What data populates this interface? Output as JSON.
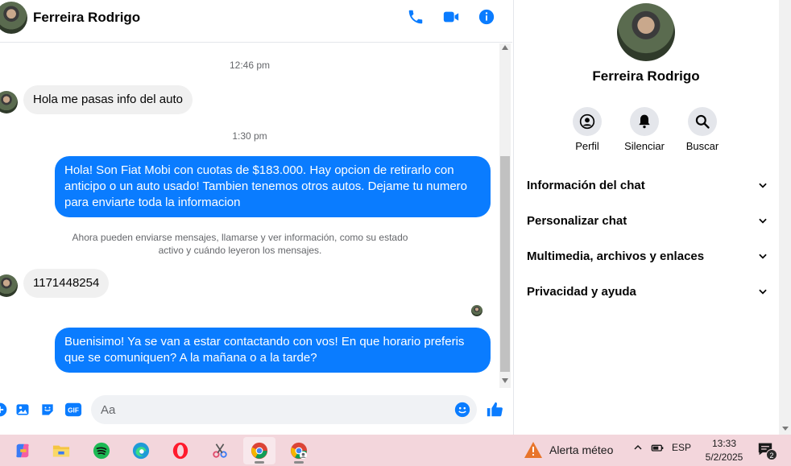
{
  "contact": {
    "name": "Ferreira Rodrigo"
  },
  "colors": {
    "accent": "#0a7cff",
    "incoming_bubble": "#f0f0f0",
    "taskbar": "#f3d6dc"
  },
  "header": {
    "icons": [
      "phone-icon",
      "video-call-icon",
      "info-icon"
    ]
  },
  "messages": {
    "time_1": "12:46 pm",
    "in_1": "Hola me pasas info del auto",
    "time_2": "1:30 pm",
    "out_1": "Hola! Son Fiat Mobi con cuotas de $183.000. Hay opcion de retirarlo con anticipo o un auto usado! Tambien tenemos otros autos. Dejame tu numero para enviarte toda la informacion",
    "system_note": "Ahora pueden enviarse mensajes, llamarse y ver información, como su estado activo y cuándo leyeron los mensajes.",
    "in_2": "1171448254",
    "out_2": "Buenisimo! Ya se van a estar contactando con vos! En que horario preferis que se comuniquen? A la mañana o a la tarde?"
  },
  "composer": {
    "placeholder": "Aa",
    "gif_label": "GIF"
  },
  "info_panel": {
    "name": "Ferreira Rodrigo",
    "actions": [
      {
        "label": "Perfil",
        "icon": "profile-icon"
      },
      {
        "label": "Silenciar",
        "icon": "bell-icon"
      },
      {
        "label": "Buscar",
        "icon": "search-icon"
      }
    ],
    "sections": [
      "Información del chat",
      "Personalizar chat",
      "Multimedia, archivos y enlaces",
      "Privacidad y ayuda"
    ]
  },
  "taskbar": {
    "apps": [
      "copilot-icon",
      "file-explorer-icon",
      "spotify-icon",
      "edge-icon",
      "opera-icon",
      "snipping-tool-icon",
      "chrome-icon",
      "chrome-profile-icon"
    ],
    "weather_label": "Alerta méteo",
    "language": "ESP",
    "time": "13:33",
    "date": "5/2/2025",
    "notification_count": "2"
  }
}
